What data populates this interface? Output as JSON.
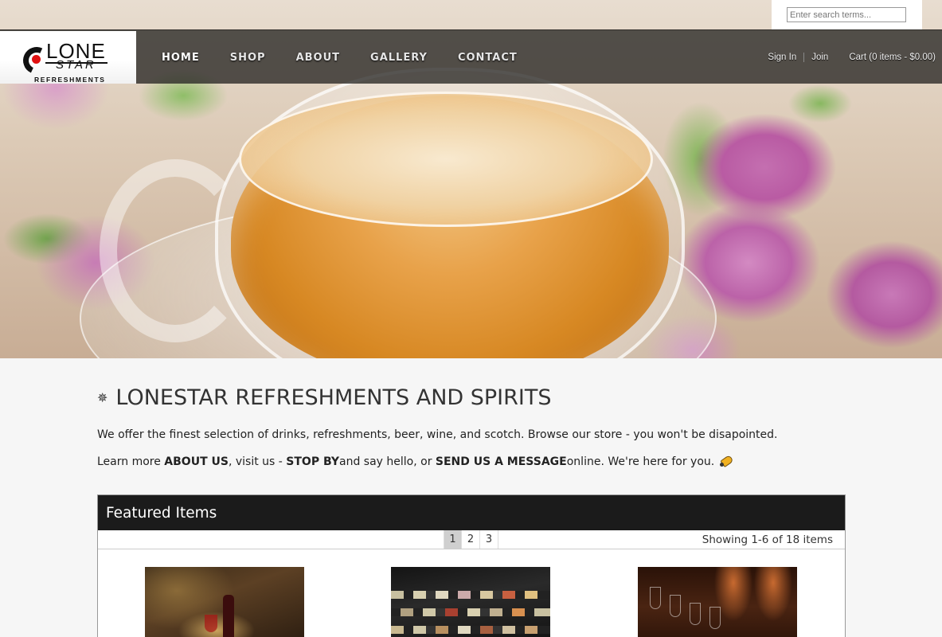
{
  "search": {
    "placeholder": "Enter search terms..."
  },
  "logo": {
    "word_top": "LONE",
    "word_bottom": "STAR",
    "tagline": "REFRESHMENTS"
  },
  "nav": {
    "items": [
      {
        "label": "HOME",
        "active": true
      },
      {
        "label": "SHOP",
        "active": false
      },
      {
        "label": "ABOUT",
        "active": false
      },
      {
        "label": "GALLERY",
        "active": false
      },
      {
        "label": "CONTACT",
        "active": false
      }
    ]
  },
  "user": {
    "sign_in": "Sign In",
    "join": "Join",
    "cart": "Cart (0 items - $0.00)"
  },
  "main": {
    "title": "LONESTAR REFRESHMENTS AND SPIRITS",
    "intro": "We offer the finest selection of drinks, refreshments, beer, wine, and scotch. Browse our store - you won't be disapointed.",
    "learn": {
      "part1": "Learn more ",
      "about_us": "ABOUT US",
      "part2": ", visit us - ",
      "stop_by": "STOP BY",
      "part3": " and say hello, or ",
      "send_message": "SEND US A MESSAGE",
      "part4": " online. We're here for you."
    }
  },
  "featured": {
    "heading": "Featured Items",
    "pages": [
      "1",
      "2",
      "3"
    ],
    "current_page": "1",
    "showing": "Showing 1-6 of 18 items"
  },
  "icons": {
    "title": "star-icon",
    "learn": "rocket-icon"
  },
  "colors": {
    "navbar": "#2a2826",
    "featured_header": "#1b1b1b",
    "page_bg": "#f6f6f6"
  }
}
